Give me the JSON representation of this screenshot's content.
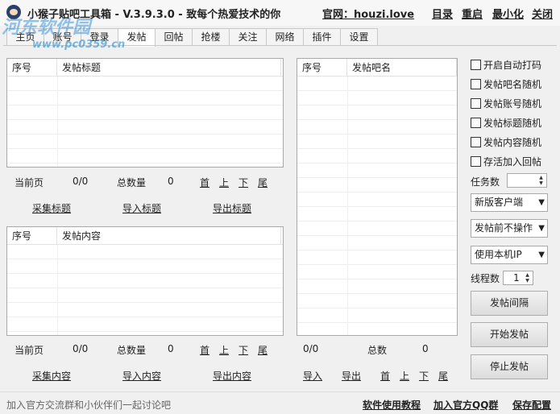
{
  "app": {
    "title": "小猴子贴吧工具箱 - V.3.9.3.0 - 致每个热爱技术的你",
    "website": "官网：houzi.love",
    "top_buttons": [
      "目录",
      "重启",
      "最小化",
      "关闭"
    ]
  },
  "watermark": {
    "text": "河东软件园",
    "url": "www.pc0359.cn"
  },
  "tabs": [
    "主页",
    "账号",
    "登录",
    "发帖",
    "回帖",
    "抢楼",
    "关注",
    "网络",
    "插件",
    "设置"
  ],
  "active_tab": "发帖",
  "title_grid": {
    "col_index": "序号",
    "col_name": "发帖标题",
    "rows": []
  },
  "title_pager": {
    "current_label": "当前页",
    "current_value": "0/0",
    "total_label": "总数量",
    "total_value": "0",
    "nav": [
      "首",
      "上",
      "下",
      "尾"
    ]
  },
  "title_actions": [
    "采集标题",
    "导入标题",
    "导出标题"
  ],
  "content_grid": {
    "col_index": "序号",
    "col_name": "发帖内容",
    "rows": []
  },
  "content_pager": {
    "current_label": "当前页",
    "current_value": "0/0",
    "total_label": "总数量",
    "total_value": "0",
    "nav": [
      "首",
      "上",
      "下",
      "尾"
    ]
  },
  "content_actions": [
    "采集内容",
    "导入内容",
    "导出内容"
  ],
  "bar_grid": {
    "col_index": "序号",
    "col_name": "发帖吧名",
    "rows": []
  },
  "bar_pager": {
    "current_value": "0/0",
    "total_label": "总数",
    "total_value": "0",
    "actions": [
      "导入",
      "导出"
    ],
    "nav": [
      "首",
      "上",
      "下",
      "尾"
    ]
  },
  "options": {
    "checkboxes": [
      "开启自动打码",
      "发帖吧名随机",
      "发帖账号随机",
      "发帖标题随机",
      "发帖内容随机",
      "存活加入回帖"
    ],
    "task_count_label": "任务数",
    "task_count_value": "",
    "client_select": "新版客户端",
    "before_post_select": "发帖前不操作",
    "ip_select": "使用本机IP",
    "thread_label": "线程数",
    "thread_value": "1",
    "buttons": [
      "发帖间隔",
      "开始发帖",
      "停止发帖"
    ]
  },
  "status": {
    "left_text": "加入官方交流群和小伙伴们一起讨论吧",
    "links": [
      "软件使用教程",
      "加入官方QQ群",
      "保存配置"
    ]
  },
  "colors": {
    "watermark": "#3c96dc",
    "grid_border": "#a9a9a9",
    "button_face": "#e6e6e6"
  }
}
